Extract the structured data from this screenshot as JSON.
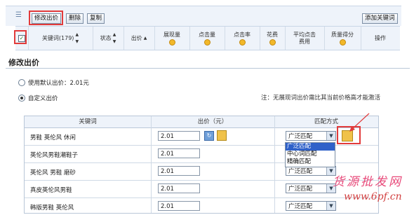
{
  "toolbar": {
    "modify_bid": "修改出价",
    "delete": "删除",
    "copy": "复制",
    "add_keyword": "添加关键词"
  },
  "header": {
    "keyword": "关键词(179)",
    "status": "状态",
    "bid": "出价",
    "impressions": "展现量",
    "clicks": "点击量",
    "ctr": "点击率",
    "spend": "花费",
    "avg_cpc_line1": "平均点击",
    "avg_cpc_line2": "费用",
    "quality_score": "质量得分",
    "action": "操作"
  },
  "section": {
    "title": "修改出价",
    "option_default": "使用默认出价：2.01元",
    "option_custom": "自定义出价",
    "note": "注：无展现词出价需比其当前价格高才能激活"
  },
  "table": {
    "col_keyword": "关键词",
    "col_bid": "出价（元）",
    "col_match": "匹配方式",
    "rows": [
      {
        "keyword": "男鞋 英伦风 休闲",
        "bid": "2.01",
        "match": "广泛匹配"
      },
      {
        "keyword": "英伦风男鞋潮鞋子",
        "bid": "2.01",
        "match": ""
      },
      {
        "keyword": "英伦风 男鞋 磨砂",
        "bid": "2.01",
        "match": "广泛匹配"
      },
      {
        "keyword": "真皮英伦风男鞋",
        "bid": "2.01",
        "match": "广泛匹配"
      },
      {
        "keyword": "韩版男鞋 英伦风",
        "bid": "2.01",
        "match": "广泛匹配"
      }
    ]
  },
  "dropdown": {
    "options": [
      "广泛匹配",
      "中心词匹配",
      "精确匹配"
    ],
    "selected_index": 0
  },
  "watermark": {
    "line1": "货源批发网",
    "line2": "www.6pf.cn"
  },
  "colors": {
    "highlight": "#e23b3b",
    "header_bg": "#eef3fa",
    "selected_option": "#2f61c9"
  }
}
